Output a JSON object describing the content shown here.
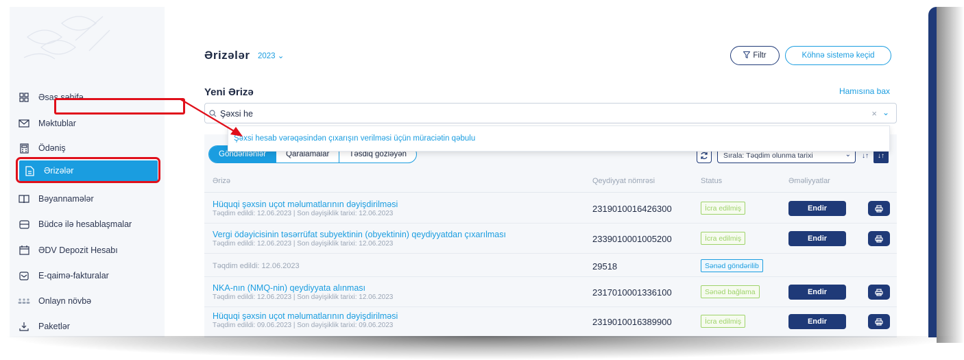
{
  "sidebar": {
    "items": [
      {
        "label": "Əsas səhifə",
        "icon": "grid-icon"
      },
      {
        "label": "Məktublar",
        "icon": "mail-icon"
      },
      {
        "label": "Ödəniş",
        "icon": "calculator-icon"
      },
      {
        "label": "Ərizələr",
        "icon": "document-icon",
        "active": true
      },
      {
        "label": "Bəyannamələr",
        "icon": "book-icon"
      },
      {
        "label": "Büdcə ilə hesablaşmalar",
        "icon": "database-icon"
      },
      {
        "label": "ƏDV Depozit Hesabı",
        "icon": "calendar-icon"
      },
      {
        "label": "E-qaimə-fakturalar",
        "icon": "inbox-icon"
      },
      {
        "label": "Onlayn növbə",
        "icon": "people-icon"
      },
      {
        "label": "Paketlər",
        "icon": "download-icon"
      }
    ]
  },
  "header": {
    "title": "Ərizələr",
    "year": "2023",
    "filter_label": "Filtr",
    "old_system_label": "Köhnə sistemə keçid"
  },
  "new_application": {
    "title": "Yeni Ərizə",
    "see_all": "Hamısına bax"
  },
  "search": {
    "value": "Şəxsi he",
    "suggestion": "Şəxsi hesab vərəqəsindən çıxarışın verilməsi üçün müraciətin qəbulu"
  },
  "tabs": [
    {
      "label": "Göndərilənlər",
      "active": true
    },
    {
      "label": "Qaralamalar",
      "active": false
    },
    {
      "label": "Təsdiq gözləyən",
      "active": false
    }
  ],
  "sort": {
    "label": "Sırala: Təqdim olunma tarixi"
  },
  "table": {
    "headers": [
      "Ərizə",
      "Qeydiyyat nömrəsi",
      "Status",
      "Əməliyyatlar"
    ],
    "download_label": "Endir",
    "rows": [
      {
        "title": "Hüquqi şəxsin uçot məlumatlarının dəyişdirilməsi",
        "subtitle": "Təqdim edildi: 12.06.2023 | Son dəyişiklik tarixi: 12.06.2023",
        "reg": "2319010016426300",
        "status": "İcra edilmiş",
        "status_color": "green",
        "actions": true
      },
      {
        "title": "Vergi ödəyicisinin təsərrüfat subyektinin (obyektinin) qeydiyyatdan çıxarılması",
        "subtitle": "Təqdim edildi: 12.06.2023 | Son dəyişiklik tarixi: 12.06.2023",
        "reg": "2339010001005200",
        "status": "İcra edilmiş",
        "status_color": "green",
        "actions": true
      },
      {
        "title": "",
        "subtitle": "Təqdim edildi: 12.06.2023",
        "reg": "29518",
        "status": "Sənəd göndərilib",
        "status_color": "blue",
        "actions": false
      },
      {
        "title": "NKA-nın (NMQ-nin) qeydiyyata alınması",
        "subtitle": "Təqdim edildi: 12.06.2023 | Son dəyişiklik tarixi: 12.06.2023",
        "reg": "2317010001336100",
        "status": "Sənəd bağlama",
        "status_color": "green",
        "actions": true
      },
      {
        "title": "Hüquqi şəxsin uçot məlumatlarının dəyişdirilməsi",
        "subtitle": "Təqdim edildi: 09.06.2023 | Son dəyişiklik tarixi: 09.06.2023",
        "reg": "2319010016389900",
        "status": "İcra edilmiş",
        "status_color": "green",
        "actions": true
      }
    ]
  },
  "colors": {
    "accent": "#1a9de0",
    "navy": "#1f3a78",
    "highlight": "#e0101b",
    "success": "#9ed36a"
  }
}
